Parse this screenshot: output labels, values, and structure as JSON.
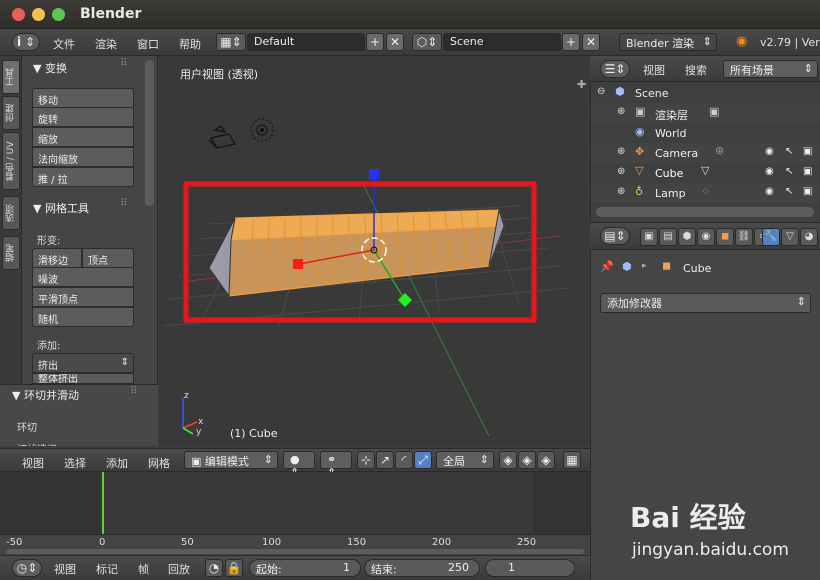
{
  "window": {
    "title": "Blender"
  },
  "info_bar": {
    "info_icon": "i",
    "menus": [
      "文件",
      "渲染",
      "窗口",
      "帮助"
    ],
    "screen_layout": "Default",
    "scene": "Scene",
    "render_engine": "Blender 渲染",
    "version": "v2.79 | Ver"
  },
  "tool_shelf": {
    "tabs": [
      "工具",
      "创建",
      "着色 / UV",
      "选项",
      "蜡笔"
    ],
    "transform_panel": {
      "title": "▼ 变换",
      "buttons": [
        "移动",
        "旋转",
        "缩放",
        "法向缩放",
        "推 / 拉"
      ]
    },
    "mesh_tools_panel": {
      "title": "▼ 网格工具",
      "deform_label": "形变:",
      "slide_edge": "滑移边",
      "vertex": "顶点",
      "buttons": [
        "噪波",
        "平滑顶点",
        "随机"
      ],
      "add_label": "添加:",
      "extrude": "挤出",
      "extrude_individual": "整体挤出"
    },
    "loop_cut_panel": {
      "title": "▼ 环切并滑动",
      "loop_cut": "环切",
      "next": "切线选择"
    }
  },
  "viewport": {
    "title": "用户视图 (透视)",
    "object_label": "(1) Cube",
    "axis_x": "x",
    "axis_y": "y",
    "axis_z": "z"
  },
  "viewport_header": {
    "menus": [
      "视图",
      "选择",
      "添加",
      "网格"
    ],
    "mode": "编辑模式",
    "pivot": "全局"
  },
  "timeline": {
    "ticks": [
      "-50",
      "0",
      "50",
      "100",
      "150",
      "200",
      "250"
    ],
    "current_frame": 1
  },
  "timeline_header": {
    "menus": [
      "视图",
      "标记",
      "帧",
      "回放"
    ],
    "start_label": "起始:",
    "start_value": "1",
    "end_label": "结束:",
    "end_value": "250",
    "current": "1"
  },
  "outliner": {
    "header_menus": [
      "视图",
      "搜索"
    ],
    "filter": "所有场景",
    "items": [
      {
        "name": "Scene",
        "indent": 0
      },
      {
        "name": "渲染层",
        "indent": 1
      },
      {
        "name": "World",
        "indent": 1
      },
      {
        "name": "Camera",
        "indent": 1
      },
      {
        "name": "Cube",
        "indent": 1
      },
      {
        "name": "Lamp",
        "indent": 1
      }
    ]
  },
  "properties": {
    "breadcrumb_object": "Cube",
    "add_modifier": "添加修改器"
  },
  "watermark": {
    "text": "Bai 经验",
    "url": "jingyan.baidu.com"
  },
  "colors": {
    "highlight_box": "#e8151b",
    "selection_orange": "#f5a13a",
    "timeline_cursor": "#5ad82a",
    "macos_close": "#ec5f55",
    "macos_min": "#f4bf4f",
    "macos_max": "#5fc454"
  }
}
